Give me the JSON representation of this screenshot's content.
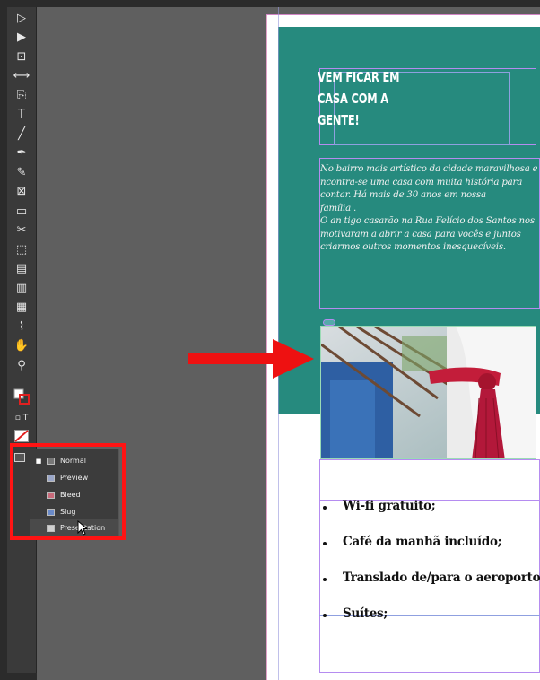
{
  "tools": [
    {
      "name": "selection-tool-icon",
      "glyph": "▷"
    },
    {
      "name": "direct-selection-tool-icon",
      "glyph": "▶"
    },
    {
      "name": "page-tool-icon",
      "glyph": "⊡"
    },
    {
      "name": "gap-tool-icon",
      "glyph": "⟷"
    },
    {
      "name": "content-collector-icon",
      "glyph": "⎘"
    },
    {
      "name": "type-tool-icon",
      "glyph": "T"
    },
    {
      "name": "line-tool-icon",
      "glyph": "╱"
    },
    {
      "name": "pen-tool-icon",
      "glyph": "✒"
    },
    {
      "name": "pencil-tool-icon",
      "glyph": "✎"
    },
    {
      "name": "rectangle-frame-tool-icon",
      "glyph": "⊠"
    },
    {
      "name": "rectangle-tool-icon",
      "glyph": "▭"
    },
    {
      "name": "scissors-tool-icon",
      "glyph": "✂"
    },
    {
      "name": "free-transform-tool-icon",
      "glyph": "⬚"
    },
    {
      "name": "gradient-swatch-tool-icon",
      "glyph": "▤"
    },
    {
      "name": "gradient-feather-tool-icon",
      "glyph": "▥"
    },
    {
      "name": "note-tool-icon",
      "glyph": "▦"
    },
    {
      "name": "eyedropper-tool-icon",
      "glyph": "⌇"
    },
    {
      "name": "hand-tool-icon",
      "glyph": "✋"
    },
    {
      "name": "zoom-tool-icon",
      "glyph": "⚲"
    }
  ],
  "headline": [
    "VEM FICAR EM",
    "CASA COM A",
    "GENTE!"
  ],
  "body_lines": [
    "No bairro mais artístico da cidade maravilhosa e",
    "ncontra-se uma casa com muita história para",
    "contar. Há mais de 30 anos em nossa",
    "família .",
    "O an tigo casarão na Rua Felício dos Santos nos",
    "motivaram a abrir a casa para vocês e juntos",
    "criarmos outros momentos inesquecíveis."
  ],
  "bullets": [
    "Wi-fi gratuito;",
    "Café da manhã incluído;",
    "Translado de/para o aeroporto;",
    "Suítes;"
  ],
  "screen_mode_menu": {
    "items": [
      {
        "label": "Normal",
        "checked": true,
        "swatch": "#8a8a8a"
      },
      {
        "label": "Preview",
        "checked": false,
        "swatch": "#9aa6c8"
      },
      {
        "label": "Bleed",
        "checked": false,
        "swatch": "#c86a7a"
      },
      {
        "label": "Slug",
        "checked": false,
        "swatch": "#6a8ac8"
      },
      {
        "label": "Presentation",
        "checked": false,
        "swatch": "#d0d0d0"
      }
    ]
  },
  "colors": {
    "teal": "#268a7e",
    "highlight": "#ff1414",
    "arrow": "#ee1111"
  }
}
